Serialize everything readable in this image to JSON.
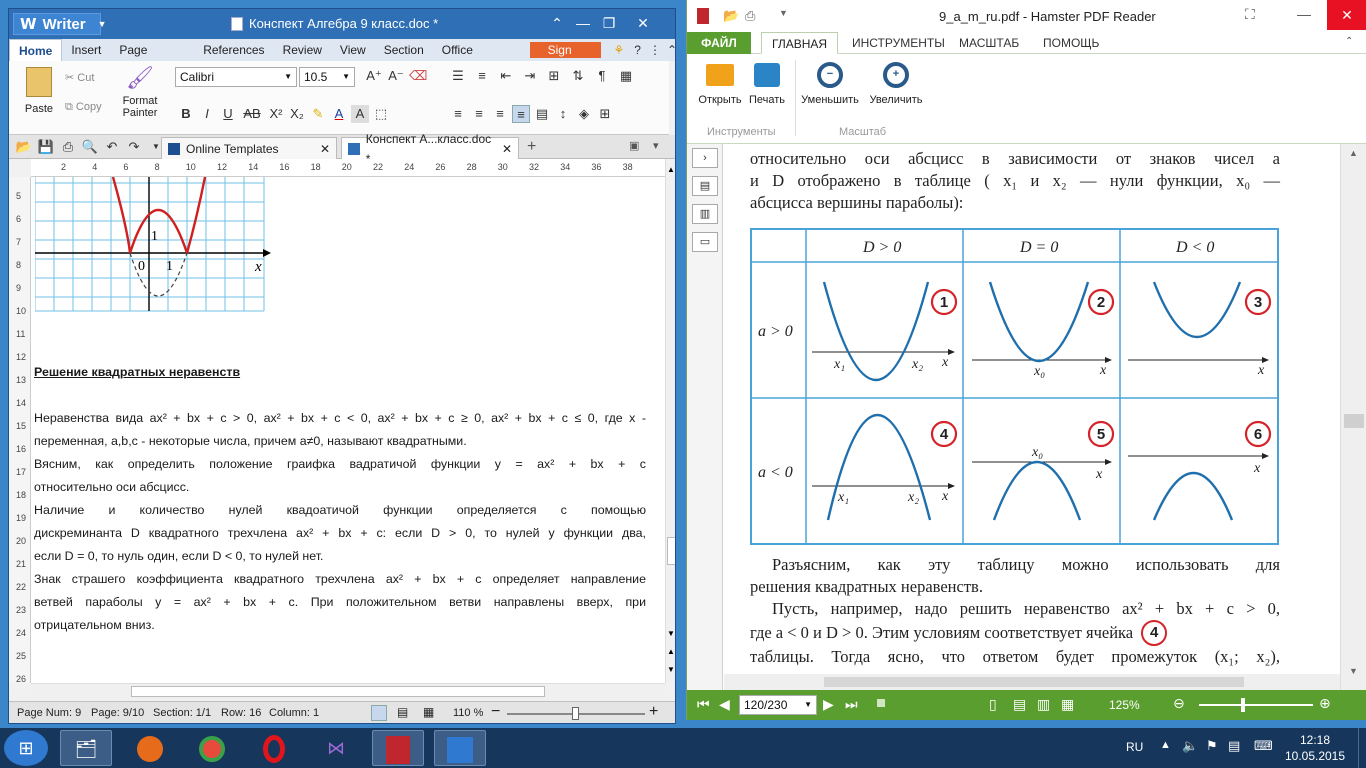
{
  "writer": {
    "app_name": "Writer",
    "doc_title": "Конспект Алгебра 9 класс.doc *",
    "menu": [
      "Home",
      "Insert",
      "Page Layout",
      "References",
      "Review",
      "View",
      "Section",
      "Office Space"
    ],
    "sign_in": "Sign in",
    "ribbon": {
      "paste": "Paste",
      "cut": "Cut",
      "copy": "Copy",
      "format_painter_1": "Format",
      "format_painter_2": "Painter",
      "font_name": "Calibri",
      "font_size": "10.5"
    },
    "tabs": {
      "online": "Online Templates",
      "doc": "Конспект А...класс.doc *"
    },
    "ruler": [
      "2",
      "4",
      "6",
      "8",
      "10",
      "12",
      "14",
      "16",
      "18",
      "20",
      "22",
      "24",
      "26",
      "28",
      "30",
      "32",
      "34",
      "36",
      "38"
    ],
    "vruler": [
      "5",
      "6",
      "7",
      "8",
      "9",
      "10",
      "11",
      "12",
      "13",
      "14",
      "15",
      "16",
      "17",
      "18",
      "19",
      "20",
      "21",
      "22",
      "23",
      "24",
      "25",
      "26"
    ],
    "graph": {
      "label_zero": "0",
      "label_one_x": "1",
      "label_one_y": "1",
      "axis_x": "x"
    },
    "heading": "Решение квадратных неравенств",
    "p1a": "Неравенства вида ax² + bx + c > 0, ax² + bx + c < 0, ax² + bx + c ≥ 0, ax² + bx + c ≤ 0, где x -",
    "p1b": "переменная, a,b,c - некоторые числа, причем a≠0, называют квадратными.",
    "p2a": "Вясним, как определить положение граифка вадратичой функции y = ax² + bx + c",
    "p2b": "относительно оси абсцисс.",
    "p3a": "Наличие и количество нулей квадоатичой функции определяется с помощью",
    "p3b": "дискреминанта D квадратного трехчлена ax² + bx + c: если D > 0, то нулей у функции два,",
    "p3c": "если D = 0, то нуль один, если D < 0, то нулей нет.",
    "p4a": "Знак страшего коэффициента квадратного трехчлена ax² + bx + c определяет направление",
    "p4b": "ветвей параболы y = ax² + bx + c. При положительном ветви направлены вверх, при",
    "p4c": "отрицательном вниз.",
    "status": {
      "page_num": "Page Num: 9",
      "page": "Page: 9/10",
      "section": "Section: 1/1",
      "row": "Row: 16",
      "column": "Column: 1",
      "zoom": "110 %"
    }
  },
  "pdf": {
    "title": "9_a_m_ru.pdf - Hamster PDF Reader",
    "tabs": [
      "ФАЙЛ",
      "ГЛАВНАЯ",
      "ИНСТРУМЕНТЫ",
      "МАСШТАБ",
      "ПОМОЩЬ"
    ],
    "buttons": {
      "open": "Открыть",
      "print": "Печать",
      "zoom_out": "Уменьшить",
      "zoom_in": "Увеличить"
    },
    "groups": {
      "tools": "Инструменты",
      "zoom": "Масштаб"
    },
    "text_top_1": "относительно оси абсцисс в зависимости от знаков чисел a",
    "text_top_2": "и D отображено в таблице ( x₁ и x₂ — нули функции, x₀ —",
    "text_top_3": "абсцисса вершины параболы):",
    "table": {
      "cols": [
        "D > 0",
        "D = 0",
        "D < 0"
      ],
      "rows": [
        "a > 0",
        "a < 0"
      ],
      "cells": [
        "1",
        "2",
        "3",
        "4",
        "5",
        "6"
      ],
      "x": "x",
      "x1": "x₁",
      "x2": "x₂",
      "x0": "x₀"
    },
    "text_bottom_1": "Разъясним, как эту таблицу можно использовать для",
    "text_bottom_2": "решения квадратных неравенств.",
    "text_bottom_3": "Пусть, например, надо решить неравенство ax² + bx + c > 0,",
    "text_bottom_4": "где a < 0 и D > 0. Этим условиям соответствует ячейка",
    "text_bottom_4_num": "4",
    "text_bottom_5": "таблицы. Тогда ясно, что ответом будет промежуток (x₁; x₂),",
    "page_field": "120/230",
    "zoom": "125%"
  },
  "taskbar": {
    "lang": "RU",
    "time": "12:18",
    "date": "10.05.2015"
  }
}
